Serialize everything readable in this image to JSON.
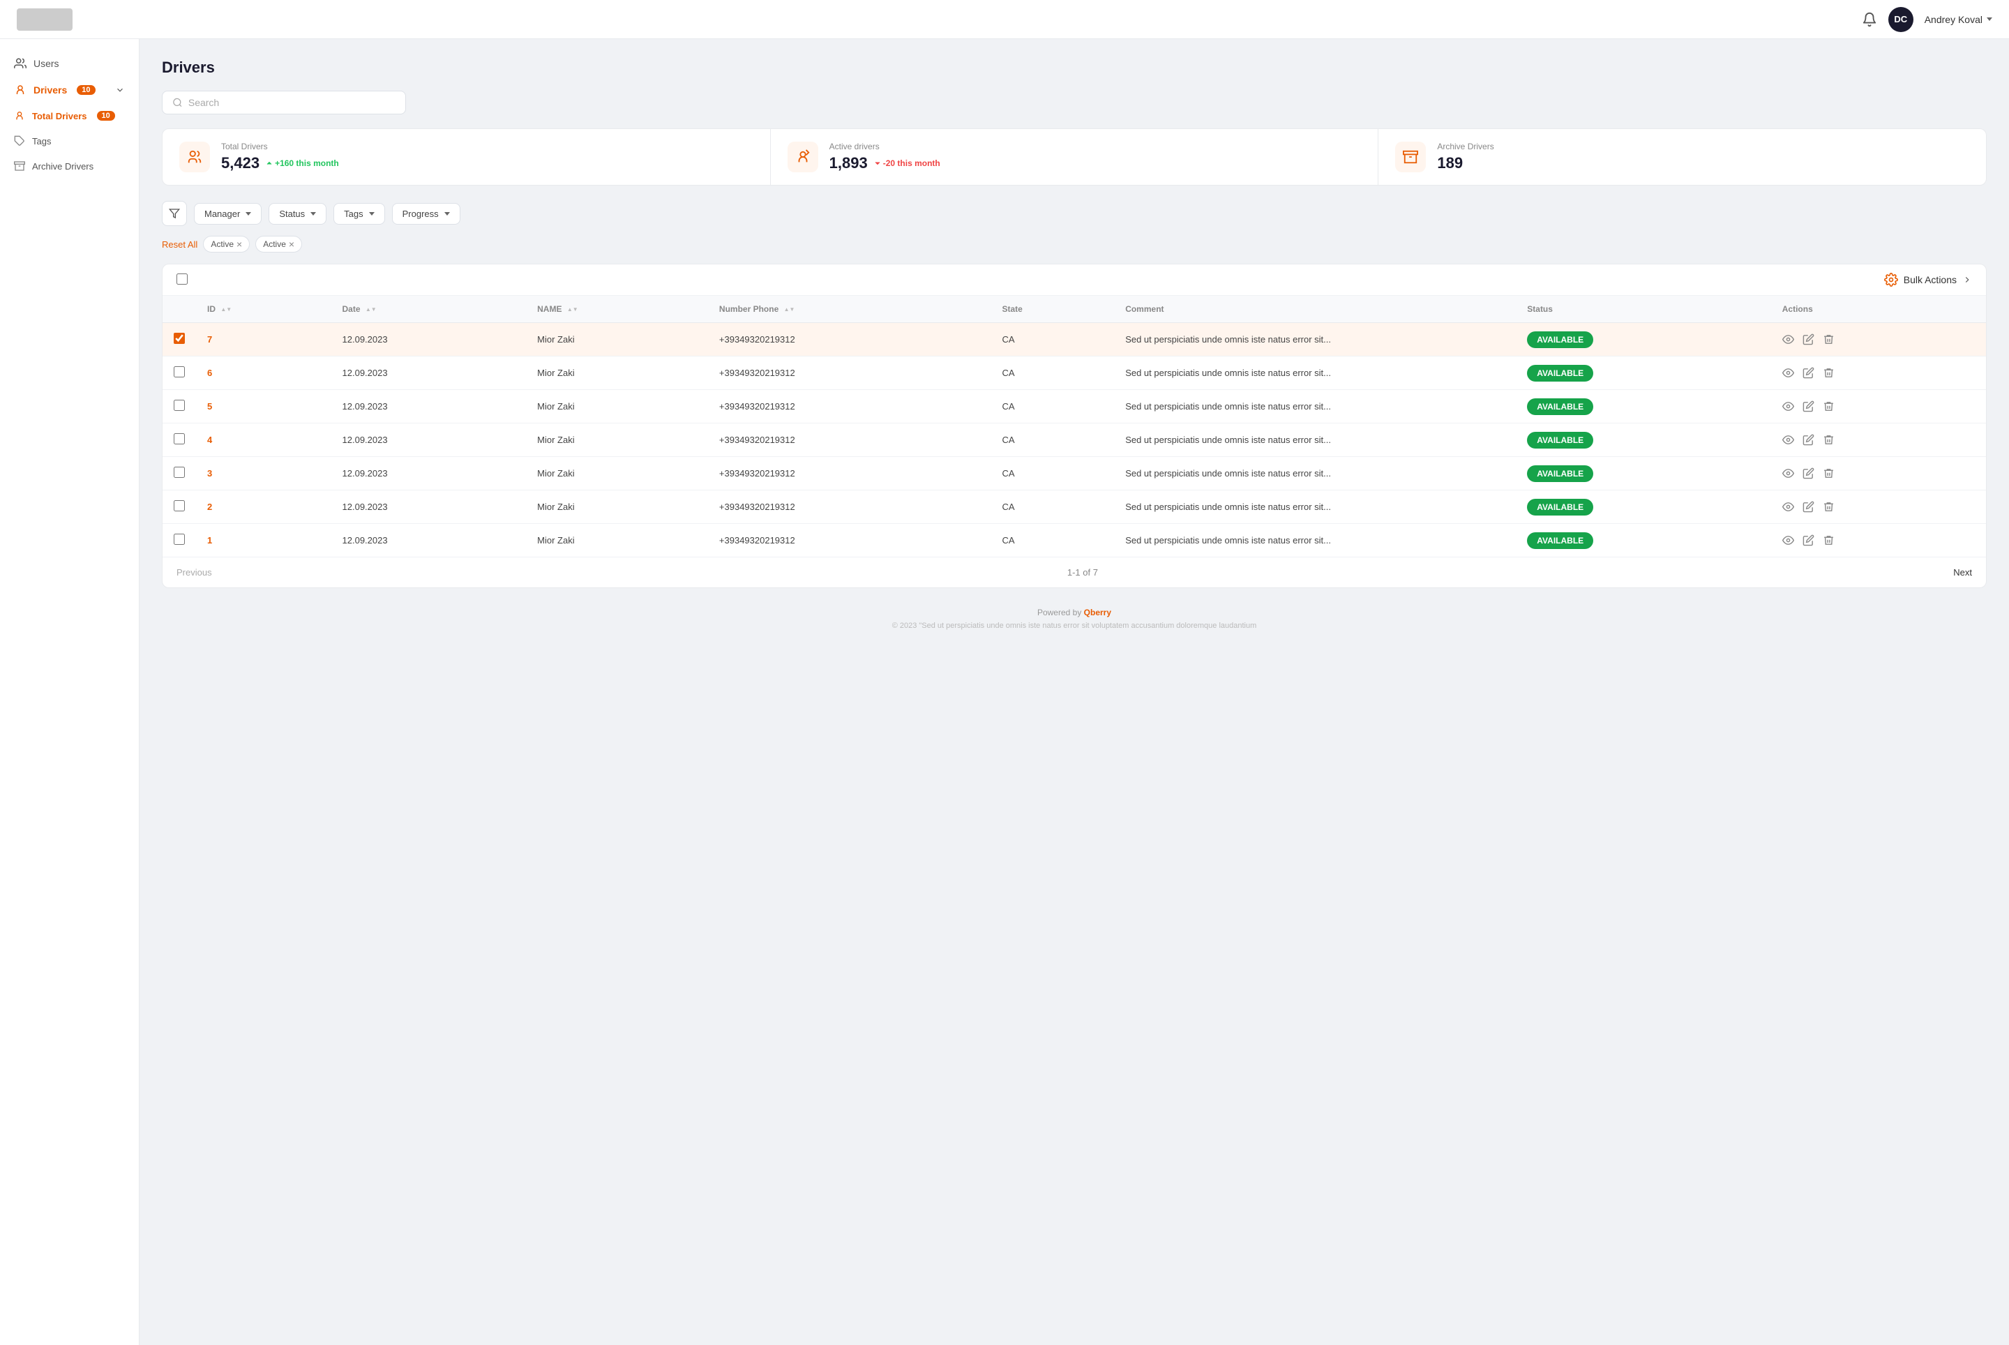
{
  "header": {
    "logo_alt": "Company Logo",
    "bell_icon": "bell",
    "user": {
      "initials": "DC",
      "name": "Andrey Koval",
      "chevron": "chevron-down"
    }
  },
  "sidebar": {
    "items": [
      {
        "id": "users",
        "label": "Users",
        "icon": "users"
      },
      {
        "id": "drivers",
        "label": "Drivers",
        "badge": "10",
        "icon": "drivers",
        "expanded": true
      }
    ],
    "drivers_sub": [
      {
        "id": "total-drivers",
        "label": "Total Drivers",
        "badge": "10",
        "active": true
      },
      {
        "id": "tags",
        "label": "Tags"
      },
      {
        "id": "archive-drivers",
        "label": "Archive Drivers"
      }
    ]
  },
  "page": {
    "title": "Drivers"
  },
  "search": {
    "placeholder": "Search"
  },
  "stats": [
    {
      "id": "total-drivers",
      "label": "Total Drivers",
      "value": "5,423",
      "change": "+160 this month",
      "change_dir": "up",
      "icon": "drivers"
    },
    {
      "id": "active-drivers",
      "label": "Active drivers",
      "value": "1,893",
      "change": "-20 this month",
      "change_dir": "down",
      "icon": "active-drivers"
    },
    {
      "id": "archive-drivers",
      "label": "Archive Drivers",
      "value": "189",
      "change": "",
      "change_dir": "",
      "icon": "archive-drivers"
    }
  ],
  "filters": {
    "manager_label": "Manager",
    "status_label": "Status",
    "tags_label": "Tags",
    "progress_label": "Progress",
    "reset_all": "Reset All",
    "active_tags": [
      "Active",
      "Active"
    ]
  },
  "table": {
    "bulk_actions_label": "Bulk Actions",
    "columns": [
      "ID",
      "Date",
      "NAME",
      "Number Phone",
      "State",
      "Comment",
      "Status",
      "Actions"
    ],
    "pagination": {
      "previous": "Previous",
      "next": "Next",
      "info": "1-1 of 7"
    },
    "rows": [
      {
        "id": "7",
        "date": "12.09.2023",
        "name": "Mior Zaki",
        "phone": "+39349320219312",
        "state": "CA",
        "comment": "Sed ut perspiciatis unde omnis iste natus error sit...",
        "status": "AVAILABLE",
        "selected": true
      },
      {
        "id": "6",
        "date": "12.09.2023",
        "name": "Mior Zaki",
        "phone": "+39349320219312",
        "state": "CA",
        "comment": "Sed ut perspiciatis unde omnis iste natus error sit...",
        "status": "AVAILABLE",
        "selected": false
      },
      {
        "id": "5",
        "date": "12.09.2023",
        "name": "Mior Zaki",
        "phone": "+39349320219312",
        "state": "CA",
        "comment": "Sed ut perspiciatis unde omnis iste natus error sit...",
        "status": "AVAILABLE",
        "selected": false
      },
      {
        "id": "4",
        "date": "12.09.2023",
        "name": "Mior Zaki",
        "phone": "+39349320219312",
        "state": "CA",
        "comment": "Sed ut perspiciatis unde omnis iste natus error sit...",
        "status": "AVAILABLE",
        "selected": false
      },
      {
        "id": "3",
        "date": "12.09.2023",
        "name": "Mior Zaki",
        "phone": "+39349320219312",
        "state": "CA",
        "comment": "Sed ut perspiciatis unde omnis iste natus error sit...",
        "status": "AVAILABLE",
        "selected": false
      },
      {
        "id": "2",
        "date": "12.09.2023",
        "name": "Mior Zaki",
        "phone": "+39349320219312",
        "state": "CA",
        "comment": "Sed ut perspiciatis unde omnis iste natus error sit...",
        "status": "AVAILABLE",
        "selected": false
      },
      {
        "id": "1",
        "date": "12.09.2023",
        "name": "Mior Zaki",
        "phone": "+39349320219312",
        "state": "CA",
        "comment": "Sed ut perspiciatis unde omnis iste natus error sit...",
        "status": "AVAILABLE",
        "selected": false
      }
    ]
  },
  "footer": {
    "powered_by": "Powered by",
    "brand": "Qberry",
    "copyright": "© 2023 \"Sed ut perspiciatis unde omnis iste natus error sit voluptatem accusantium doloremque laudantium"
  }
}
